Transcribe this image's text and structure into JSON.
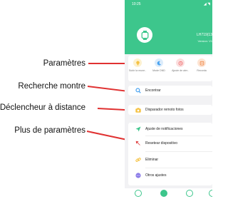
{
  "callouts": [
    {
      "label": "Paramètres"
    },
    {
      "label": "Recherche montre"
    },
    {
      "label": "Déclencheur à distance"
    },
    {
      "label": "Plus de paramètres"
    }
  ],
  "status_bar": {
    "time": "10:25",
    "icons": "◢ ◥"
  },
  "device": {
    "name": "LH719(13",
    "version": "Version: V1"
  },
  "quick_actions": [
    {
      "label": "Subir la mune..",
      "color": "#f5c242",
      "icon": "bulb-icon"
    },
    {
      "label": "Mode DND",
      "color": "#4aa3f0",
      "icon": "moon-icon"
    },
    {
      "label": "Ajuste de aler..",
      "color": "#ef6b6b",
      "icon": "alarm-icon"
    },
    {
      "label": "Recorda",
      "color": "#f08a4b",
      "icon": "reminder-icon"
    }
  ],
  "menu": {
    "find": "Encontrar",
    "camera": "Disparador remoto fotos",
    "notifications": "Ajuste de notificaciones",
    "reset": "Resetear dispositivo",
    "delete": "Eliminar",
    "other": "Otros ajustes"
  },
  "colors": {
    "brand": "#3dc68c",
    "callout": "#e03131"
  }
}
